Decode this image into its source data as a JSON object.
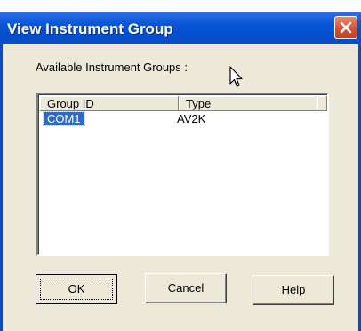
{
  "window": {
    "title": "View Instrument Group"
  },
  "dialog": {
    "available_label": "Available Instrument Groups :",
    "list": {
      "columns": [
        "Group ID",
        "Type"
      ],
      "rows": [
        {
          "group_id": "COM1",
          "type": "AV2K",
          "selected": true
        }
      ]
    },
    "buttons": {
      "ok": "OK",
      "cancel": "Cancel",
      "help": "Help"
    }
  },
  "colors": {
    "titlebar": "#0a57d6",
    "dialog_bg": "#ece9d8",
    "selection": "#316ac5",
    "close_button": "#d4502c"
  },
  "icons": {
    "close": "close-icon",
    "cursor": "mouse-pointer-icon"
  }
}
